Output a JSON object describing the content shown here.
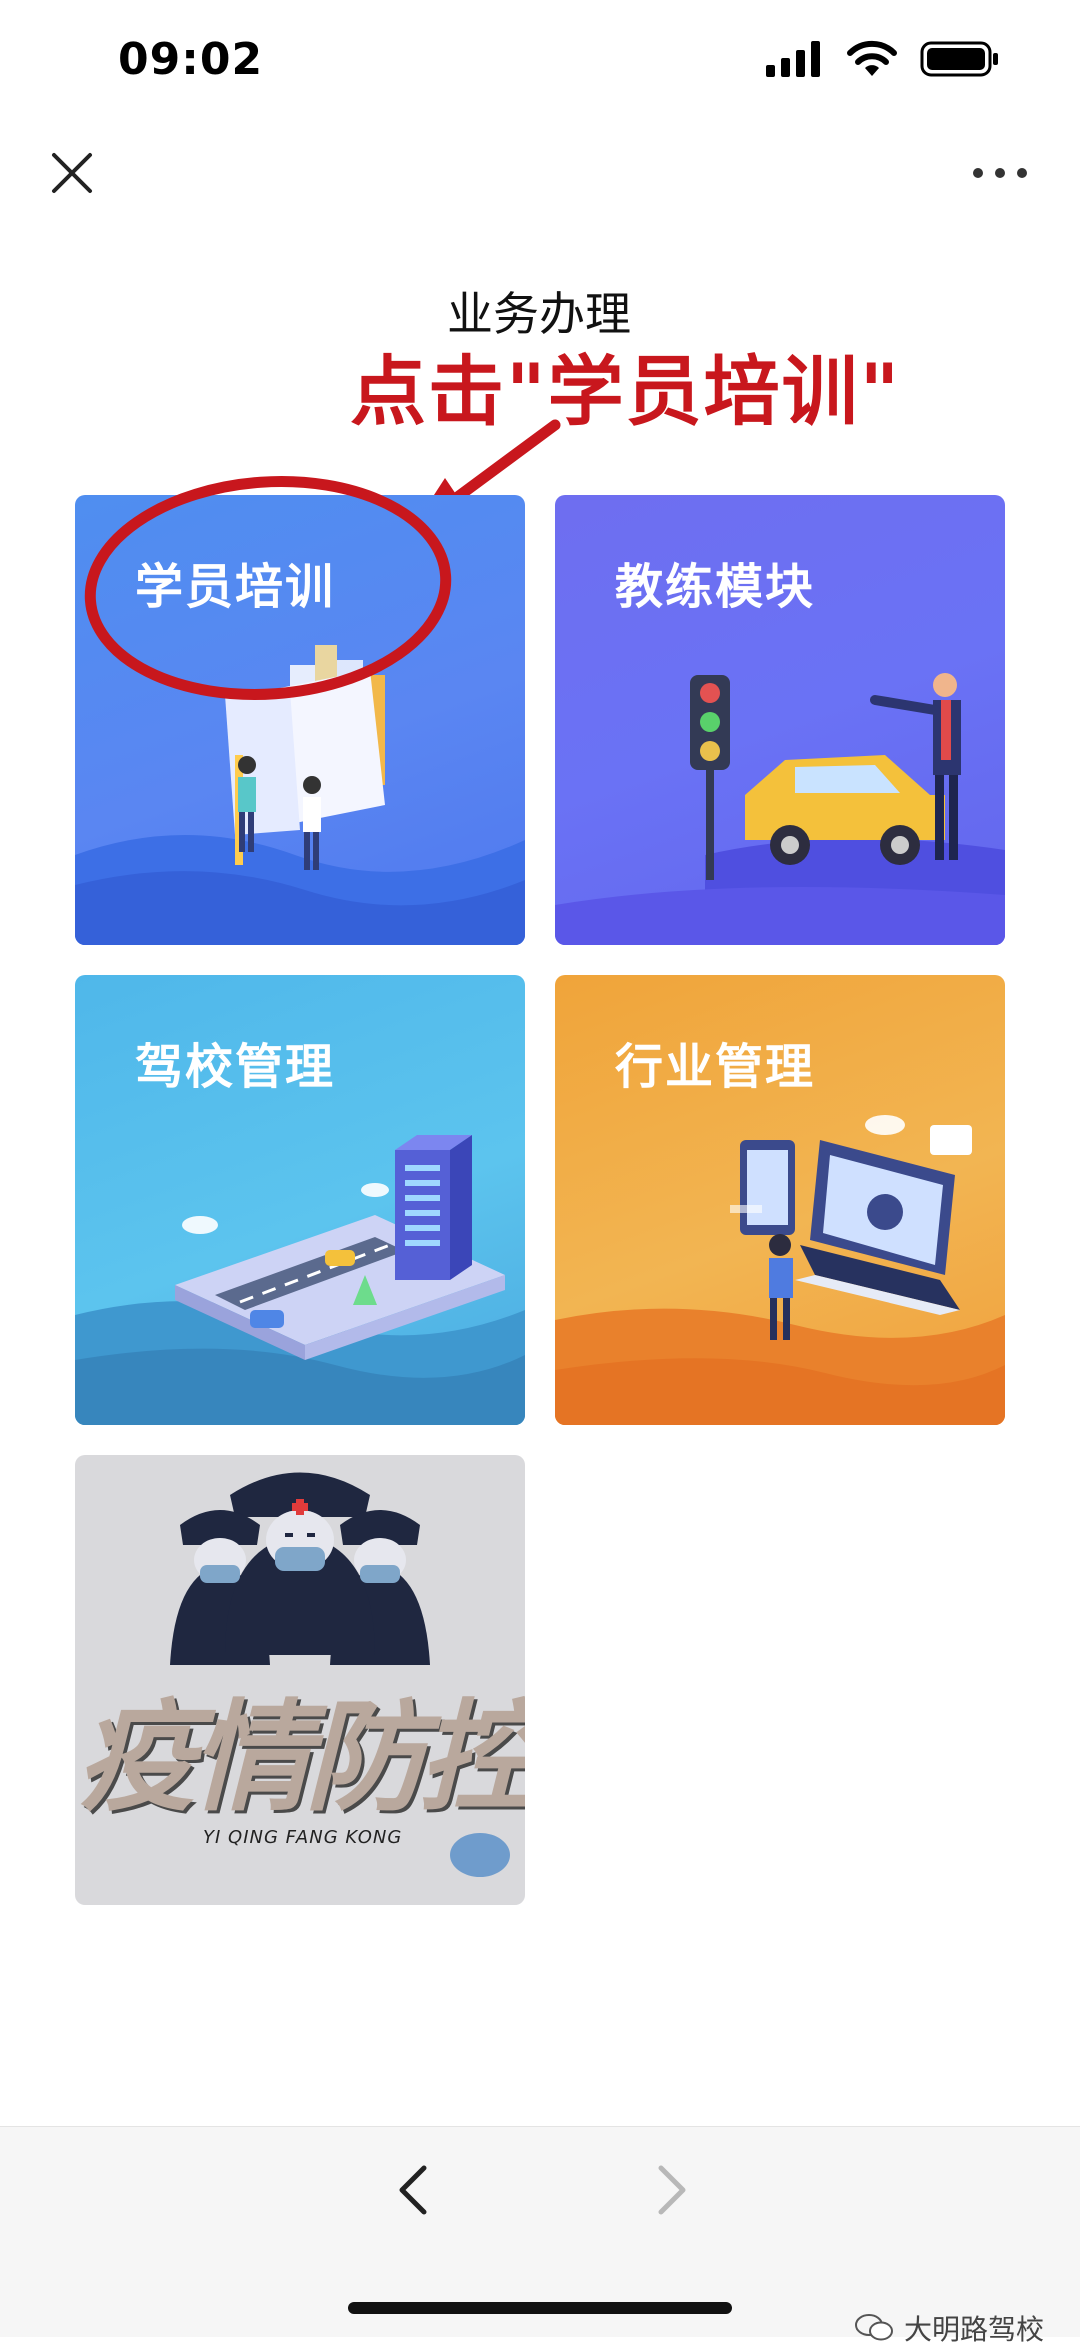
{
  "status_bar": {
    "time": "09:02"
  },
  "nav": {
    "close_icon": "close-icon",
    "more_icon": "more-icon"
  },
  "page": {
    "title": "业务办理",
    "annotation": "点击\"学员培训\""
  },
  "tiles": [
    {
      "label": "学员培训",
      "color": "#5587f1"
    },
    {
      "label": "教练模块",
      "color": "#6a6ef1"
    },
    {
      "label": "驾校管理",
      "color": "#53baea"
    },
    {
      "label": "行业管理",
      "color": "#f1a941"
    },
    {
      "label": "疫情防控",
      "sublabel": "YI QING FANG KONG",
      "color": "#d9d9dc"
    }
  ],
  "annotation_color": "#c8171d",
  "bottom": {
    "back_icon": "chevron-left-icon",
    "forward_icon": "chevron-right-icon",
    "watermark": "大明路驾校"
  }
}
